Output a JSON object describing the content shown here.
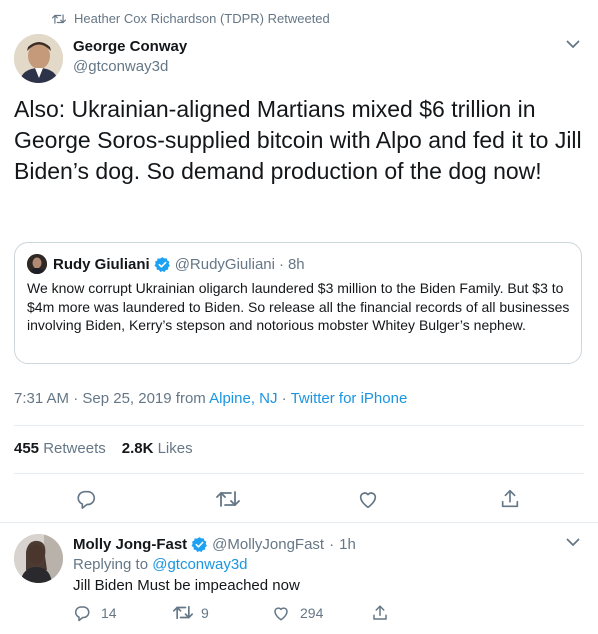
{
  "retweet_context": {
    "text": "Heather Cox Richardson (TDPR) Retweeted"
  },
  "tweet": {
    "author_name": "George Conway",
    "author_handle": "@gtconway3d",
    "text": "Also:  Ukrainian-aligned Martians mixed $6 trillion in George Soros-supplied bitcoin with Alpo and fed it to Jill Biden’s dog.  So demand production of the dog now!",
    "quoted": {
      "name": "Rudy Giuliani",
      "handle": "@RudyGiuliani",
      "separator": "·",
      "time": "8h",
      "text": "We know corrupt Ukrainian oligarch laundered $3 million to the Biden Family. But $3 to $4m more was laundered to Biden. So release all the financial records of all businesses involving Biden, Kerry’s stepson and notorious mobster Whitey Bulger’s nephew."
    },
    "timestamp": "7:31 AM · Sep 25, 2019 from ",
    "location": "Alpine, NJ",
    "meta_separator": " · ",
    "client": "Twitter for iPhone",
    "retweets_count": "455",
    "retweets_label": "Retweets",
    "likes_count": "2.8K",
    "likes_label": "Likes"
  },
  "reply": {
    "name": "Molly Jong-Fast",
    "handle": "@MollyJongFast",
    "separator": "·",
    "time": "1h",
    "replying_prefix": "Replying to ",
    "replying_to": "@gtconway3d",
    "text": "Jill Biden Must be impeached now",
    "reply_count": "14",
    "retweet_count": "9",
    "like_count": "294"
  },
  "colors": {
    "accent": "#1b95e0",
    "verified": "#1da1f2",
    "muted": "#657786",
    "border": "#e6ecf0"
  },
  "icons": [
    "retweet-icon",
    "chevron-down-icon",
    "verified-badge-icon",
    "reply-icon",
    "like-icon",
    "share-icon"
  ]
}
